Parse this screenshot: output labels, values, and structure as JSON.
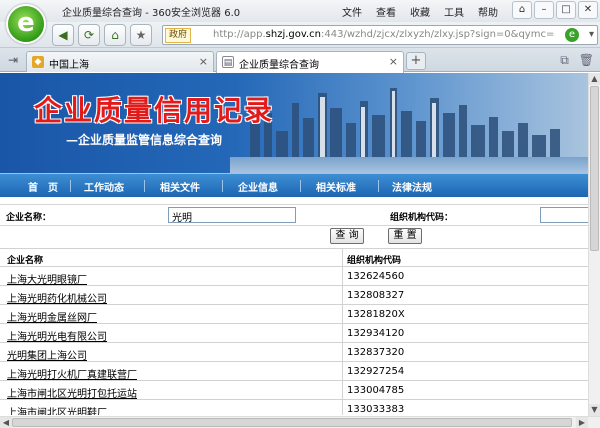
{
  "window": {
    "title": "企业质量综合查询 - 360安全浏览器 6.0",
    "menu": [
      "文件",
      "查看",
      "收藏",
      "工具",
      "帮助"
    ],
    "controls": [
      "⌂",
      "–",
      "□",
      "✕"
    ]
  },
  "addressbar": {
    "badge": "政府",
    "url_prefix": "http://app.",
    "url_domain": "shzj.gov.cn",
    "url_rest": ":443/wzhd/zjcx/zlxyzh/zlxy.jsp?sign=0&qymc="
  },
  "tabs": [
    {
      "label": "中国上海",
      "close": "×"
    },
    {
      "label": "企业质量综合查询",
      "close": "×"
    }
  ],
  "banner": {
    "title": "企业质量信用记录",
    "subtitle": "—企业质量监管信息综合查询"
  },
  "nav": [
    "首　页",
    "工作动态",
    "相关文件",
    "企业信息",
    "相关标准",
    "法律法规"
  ],
  "search": {
    "name_label": "企业名称：",
    "name_value": "光明",
    "code_label": "组织机构代码：",
    "code_value": "",
    "query_button": "查 询",
    "reset_button": "重 置"
  },
  "table": {
    "headers": [
      "企业名称",
      "组织机构代码"
    ],
    "rows": [
      {
        "name": "上海大光明眼镜厂",
        "code": "132624560"
      },
      {
        "name": "上海光明药化机械公司",
        "code": "132808327"
      },
      {
        "name": "上海光明金属丝网厂",
        "code": "13281820X"
      },
      {
        "name": "上海光明光电有限公司",
        "code": "132934120"
      },
      {
        "name": "光明集团上海公司",
        "code": "132837320"
      },
      {
        "name": "上海光明打火机厂真建联营厂",
        "code": "132927254"
      },
      {
        "name": "上海市闸北区光明打包托运站",
        "code": "133004785"
      },
      {
        "name": "上海市闸北区光明鞋厂",
        "code": "133033383"
      }
    ]
  },
  "colors": {
    "banner_title": "#e31a1a",
    "nav_blue": "#1d65b3",
    "logo_green": "#2f9a16"
  }
}
